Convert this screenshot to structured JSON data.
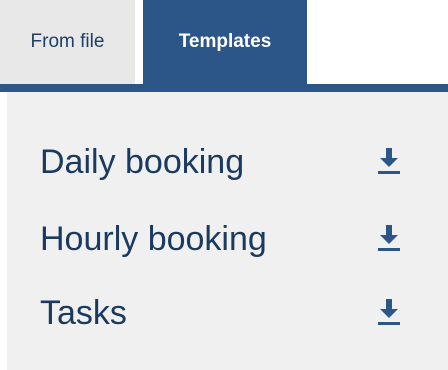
{
  "tabs": {
    "from_file": "From file",
    "templates": "Templates",
    "active": "templates"
  },
  "templates": [
    {
      "name": "Daily booking",
      "action_icon": "download-icon"
    },
    {
      "name": "Hourly booking",
      "action_icon": "download-icon"
    },
    {
      "name": "Tasks",
      "action_icon": "download-icon"
    }
  ],
  "colors": {
    "accent": "#2b5687",
    "text": "#1b3a60",
    "panel_bg": "#f0f0f0",
    "inactive_tab_bg": "#e8e8e8"
  }
}
